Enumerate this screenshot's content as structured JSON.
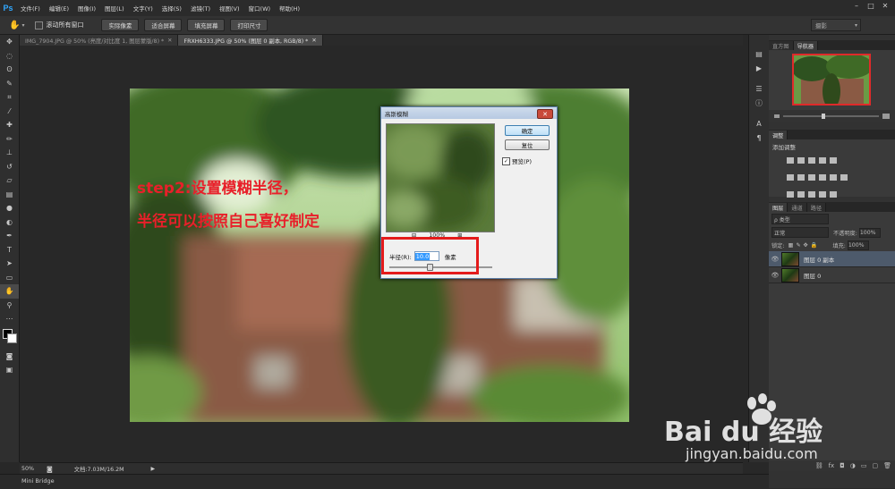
{
  "app": {
    "logo": "Ps",
    "menu": [
      "文件(F)",
      "编辑(E)",
      "图像(I)",
      "图层(L)",
      "文字(Y)",
      "选择(S)",
      "滤镜(T)",
      "视图(V)",
      "窗口(W)",
      "帮助(H)"
    ],
    "window_controls": [
      "–",
      "□",
      "✕"
    ]
  },
  "options_bar": {
    "scroll_all_label": "滚动所有窗口",
    "buttons": [
      "实际像素",
      "适合屏幕",
      "填充屏幕",
      "打印尺寸"
    ],
    "workspace": "摄影"
  },
  "doc_tabs": [
    {
      "label": "IMG_7904.JPG @ 50% (亮度/对比度 1, 图层蒙版/8) *",
      "active": false
    },
    {
      "label": "FRXH6333.JPG @ 50% (图层 0 副本, RGB/8) *",
      "active": true
    }
  ],
  "annotation": {
    "line1": "step2:设置模糊半径，",
    "line2": "半径可以按照自己喜好制定"
  },
  "dialog": {
    "title": "高斯模糊",
    "ok_label": "确定",
    "reset_label": "复位",
    "preview_label": "预览(P)",
    "preview_checked": true,
    "zoom_out": "⊟",
    "zoom_level": "100%",
    "zoom_in": "⊞",
    "radius_label": "半径(R):",
    "radius_value": "10.0",
    "radius_unit": "像素",
    "close": "✕"
  },
  "status_bar": {
    "zoom": "50%",
    "doc_info": "文档:7.03M/16.2M",
    "mini_bridge": "Mini Bridge"
  },
  "navigator_panel": {
    "tabs": [
      {
        "label": "直方图",
        "active": false
      },
      {
        "label": "导航器",
        "active": true
      }
    ]
  },
  "adjustments_panel": {
    "tabs": [
      {
        "label": "调整",
        "active": true
      }
    ],
    "subtitle": "添加调整"
  },
  "layers_panel": {
    "tabs": [
      {
        "label": "图层",
        "active": true
      },
      {
        "label": "通道",
        "active": false
      },
      {
        "label": "路径",
        "active": false
      }
    ],
    "filter_kind": "ρ 类型",
    "blend_mode": "正常",
    "opacity_label": "不透明度:",
    "opacity_value": "100%",
    "lock_label": "锁定:",
    "fill_label": "填充:",
    "fill_value": "100%",
    "layers": [
      {
        "name": "图层 0 副本",
        "selected": true
      },
      {
        "name": "图层 0",
        "selected": false
      }
    ]
  },
  "watermark": {
    "brand": "Bai du 经验",
    "url": "jingyan.baidu.com"
  },
  "colors": {
    "annotation_red": "#e8202a",
    "highlight_box": "#e41b1b",
    "ps_blue": "#31a8ff",
    "selected_layer": "#4d5a6b"
  }
}
